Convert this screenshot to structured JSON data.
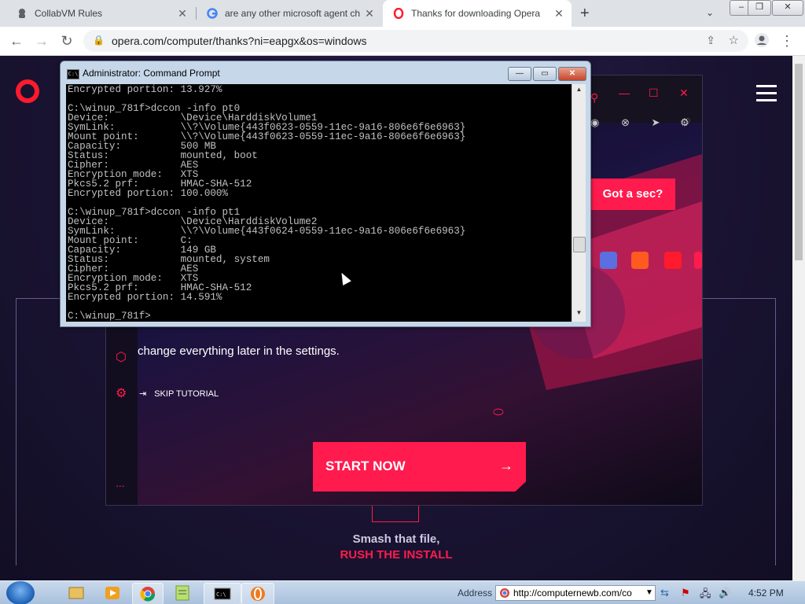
{
  "tabs": [
    {
      "label": "CollabVM Rules",
      "icon": "collabvm-icon",
      "active": false
    },
    {
      "label": "are any other microsoft agent ch",
      "icon": "google-icon",
      "active": false
    },
    {
      "label": "Thanks for downloading Opera",
      "icon": "opera-icon",
      "active": true
    }
  ],
  "toolbar": {
    "url": "opera.com/computer/thanks?ni=eapgx&os=windows"
  },
  "page": {
    "got_a_sec": "Got a sec?",
    "change_text": "change everything later in the settings.",
    "skip_tutorial": "SKIP TUTORIAL",
    "start_now": "START NOW",
    "smash_line1": "Smash that file,",
    "smash_line2": "RUSH THE INSTALL",
    "more_dots": "..."
  },
  "cmd": {
    "title": "Administrator: Command Prompt",
    "lines": [
      "Encrypted portion: 13.927%",
      "",
      "C:\\winup_781f>dccon -info pt0",
      "Device:            \\Device\\HarddiskVolume1",
      "SymLink:           \\\\?\\Volume{443f0623-0559-11ec-9a16-806e6f6e6963}",
      "Mount point:       \\\\?\\Volume{443f0623-0559-11ec-9a16-806e6f6e6963}",
      "Capacity:          500 MB",
      "Status:            mounted, boot",
      "Cipher:            AES",
      "Encryption mode:   XTS",
      "Pkcs5.2 prf:       HMAC-SHA-512",
      "Encrypted portion: 100.000%",
      "",
      "C:\\winup_781f>dccon -info pt1",
      "Device:            \\Device\\HarddiskVolume2",
      "SymLink:           \\\\?\\Volume{443f0624-0559-11ec-9a16-806e6f6e6963}",
      "Mount point:       C:",
      "Capacity:          149 GB",
      "Status:            mounted, system",
      "Cipher:            AES",
      "Encryption mode:   XTS",
      "Pkcs5.2 prf:       HMAC-SHA-512",
      "Encrypted portion: 14.591%",
      "",
      "C:\\winup_781f>"
    ]
  },
  "taskbar": {
    "address_label": "Address",
    "address_value": "http://computernewb.com/co",
    "clock": "4:52 PM"
  },
  "colors": {
    "accent": "#ff1b4d",
    "opera_red": "#ff1b2d",
    "page_bg": "#1a1433"
  }
}
